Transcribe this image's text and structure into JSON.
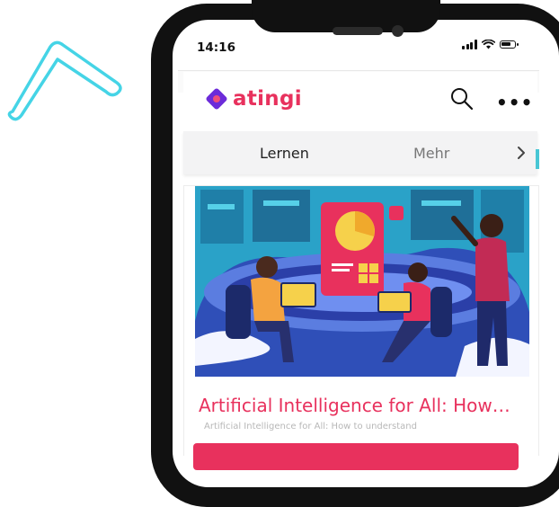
{
  "status_bar": {
    "time": "14:16"
  },
  "app": {
    "brand": "atingi",
    "brand_color": "#e8315d",
    "accent_color": "#6c2bd9"
  },
  "header": {
    "search_icon": "search-icon",
    "more_label": "•••"
  },
  "tabs": [
    {
      "label": "Lernen"
    },
    {
      "label": "Mehr"
    }
  ],
  "course": {
    "title": "Artificial Intelligence for All: How…",
    "subtitle": "Artificial Intelligence for All: How to understand"
  },
  "decor": {
    "boomerang_color": "#45d4e6"
  }
}
